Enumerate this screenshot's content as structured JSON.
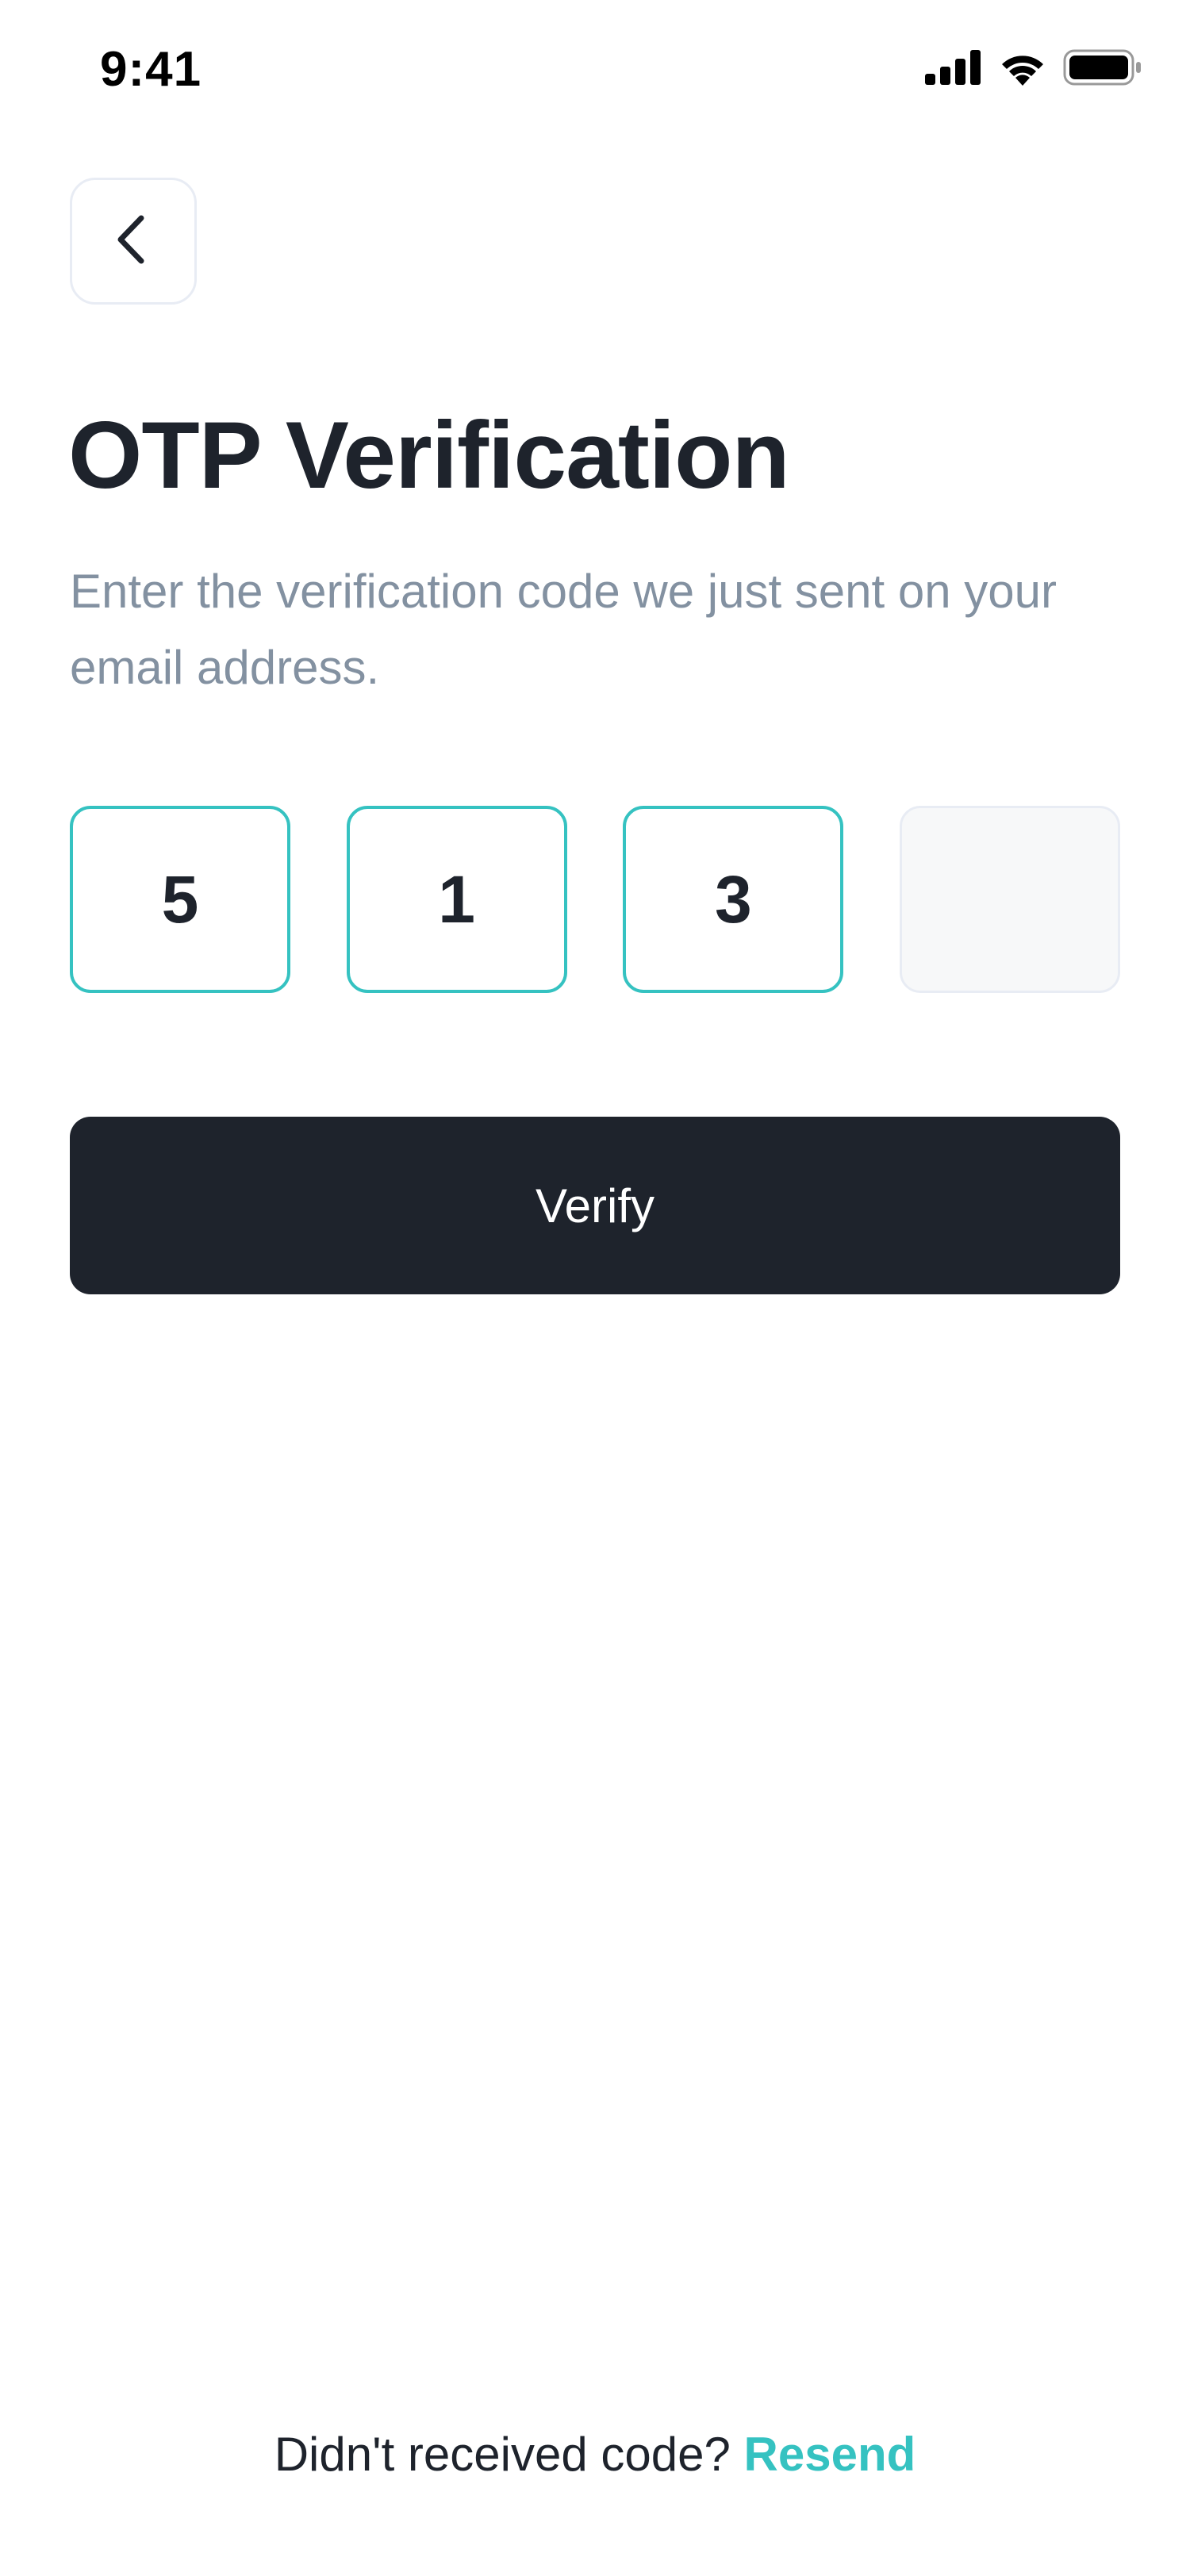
{
  "status_bar": {
    "time": "9:41",
    "icons": [
      "signal-icon",
      "wifi-icon",
      "battery-icon"
    ]
  },
  "header": {
    "back_icon": "chevron-left-icon"
  },
  "main": {
    "title": "OTP Verification",
    "subtitle": "Enter the verification code we just sent on your email address."
  },
  "otp": {
    "digits": [
      "5",
      "1",
      "3",
      ""
    ]
  },
  "actions": {
    "verify_label": "Verify"
  },
  "footer": {
    "prompt": "Didn't received code?",
    "resend_label": "Resend"
  },
  "colors": {
    "accent": "#35c2c1",
    "primary_dark": "#1e232c",
    "muted_text": "#8391a1",
    "border_light": "#e8ecf4",
    "input_empty_bg": "#f7f8f9"
  }
}
